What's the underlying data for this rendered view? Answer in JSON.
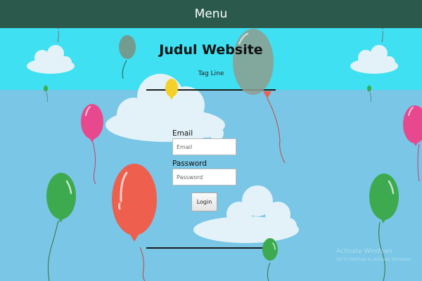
{
  "header": {
    "menu_label": "Menu"
  },
  "site": {
    "title": "Judul Website",
    "tagline": "Tag Line"
  },
  "login": {
    "email_label": "Email",
    "email_placeholder": "Email",
    "password_label": "Password",
    "password_placeholder": "Password",
    "button_label": "Login"
  },
  "watermark": {
    "line1": "Activate Windows",
    "line2": "Go to Settings to activate Windows."
  },
  "colors": {
    "menu_bar": "#2b5a4c",
    "top_band": "#3ee0f2",
    "sky": "#79c6e6",
    "balloon_red": "#ef5f4d",
    "balloon_pink": "#e8488e",
    "balloon_green": "#3daa4f",
    "balloon_yellow": "#f4d02b"
  }
}
